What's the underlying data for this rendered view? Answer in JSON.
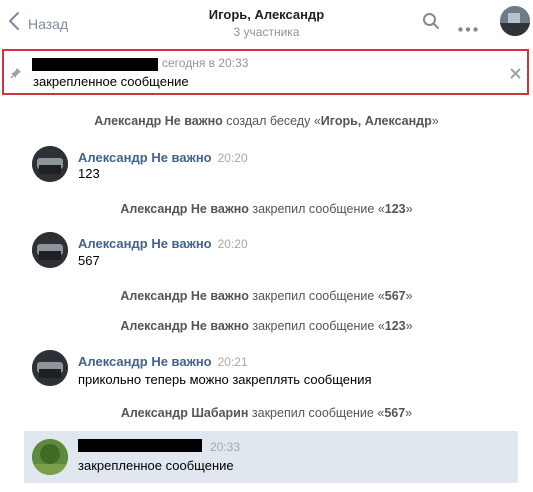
{
  "header": {
    "back_label": "Назад",
    "title": "Игорь, Александр",
    "subtitle": "3 участника",
    "icons": [
      "chevron-left-icon",
      "search-icon",
      "more-icon"
    ]
  },
  "pinned": {
    "time": "сегодня в 20:33",
    "text": "закрепленное сообщение",
    "icons": [
      "pin-icon",
      "close-icon"
    ]
  },
  "timeline": [
    {
      "type": "system",
      "actor": "Александр Не важно",
      "action": "создал беседу",
      "open_quote": "«",
      "target": "Игорь, Александр",
      "close_quote": "»"
    },
    {
      "type": "message",
      "author": "Александр Не важно",
      "time": "20:20",
      "text": "123"
    },
    {
      "type": "system",
      "actor": "Александр Не важно",
      "action": "закрепил сообщение",
      "open_quote": "«",
      "target": "123",
      "close_quote": "»"
    },
    {
      "type": "message",
      "author": "Александр Не важно",
      "time": "20:20",
      "text": "567"
    },
    {
      "type": "system",
      "actor": "Александр Не важно",
      "action": "закрепил сообщение",
      "open_quote": "«",
      "target": "567",
      "close_quote": "»"
    },
    {
      "type": "system",
      "actor": "Александр Не важно",
      "action": "закрепил сообщение",
      "open_quote": "«",
      "target": "123",
      "close_quote": "»"
    },
    {
      "type": "message",
      "author": "Александр Не важно",
      "time": "20:21",
      "text": "прикольно теперь можно закреплять сообщения"
    },
    {
      "type": "system",
      "actor": "Александр Шабарин",
      "action": "закрепил сообщение",
      "open_quote": "«",
      "target": "567",
      "close_quote": "»"
    },
    {
      "type": "message",
      "author": "",
      "time": "20:33",
      "text": "закрепленное сообщение",
      "highlighted": true
    }
  ],
  "colors": {
    "accent": "#42648b",
    "pinned_border": "#d0343a",
    "highlight_bg": "#e1e7ef",
    "muted": "#939393"
  }
}
